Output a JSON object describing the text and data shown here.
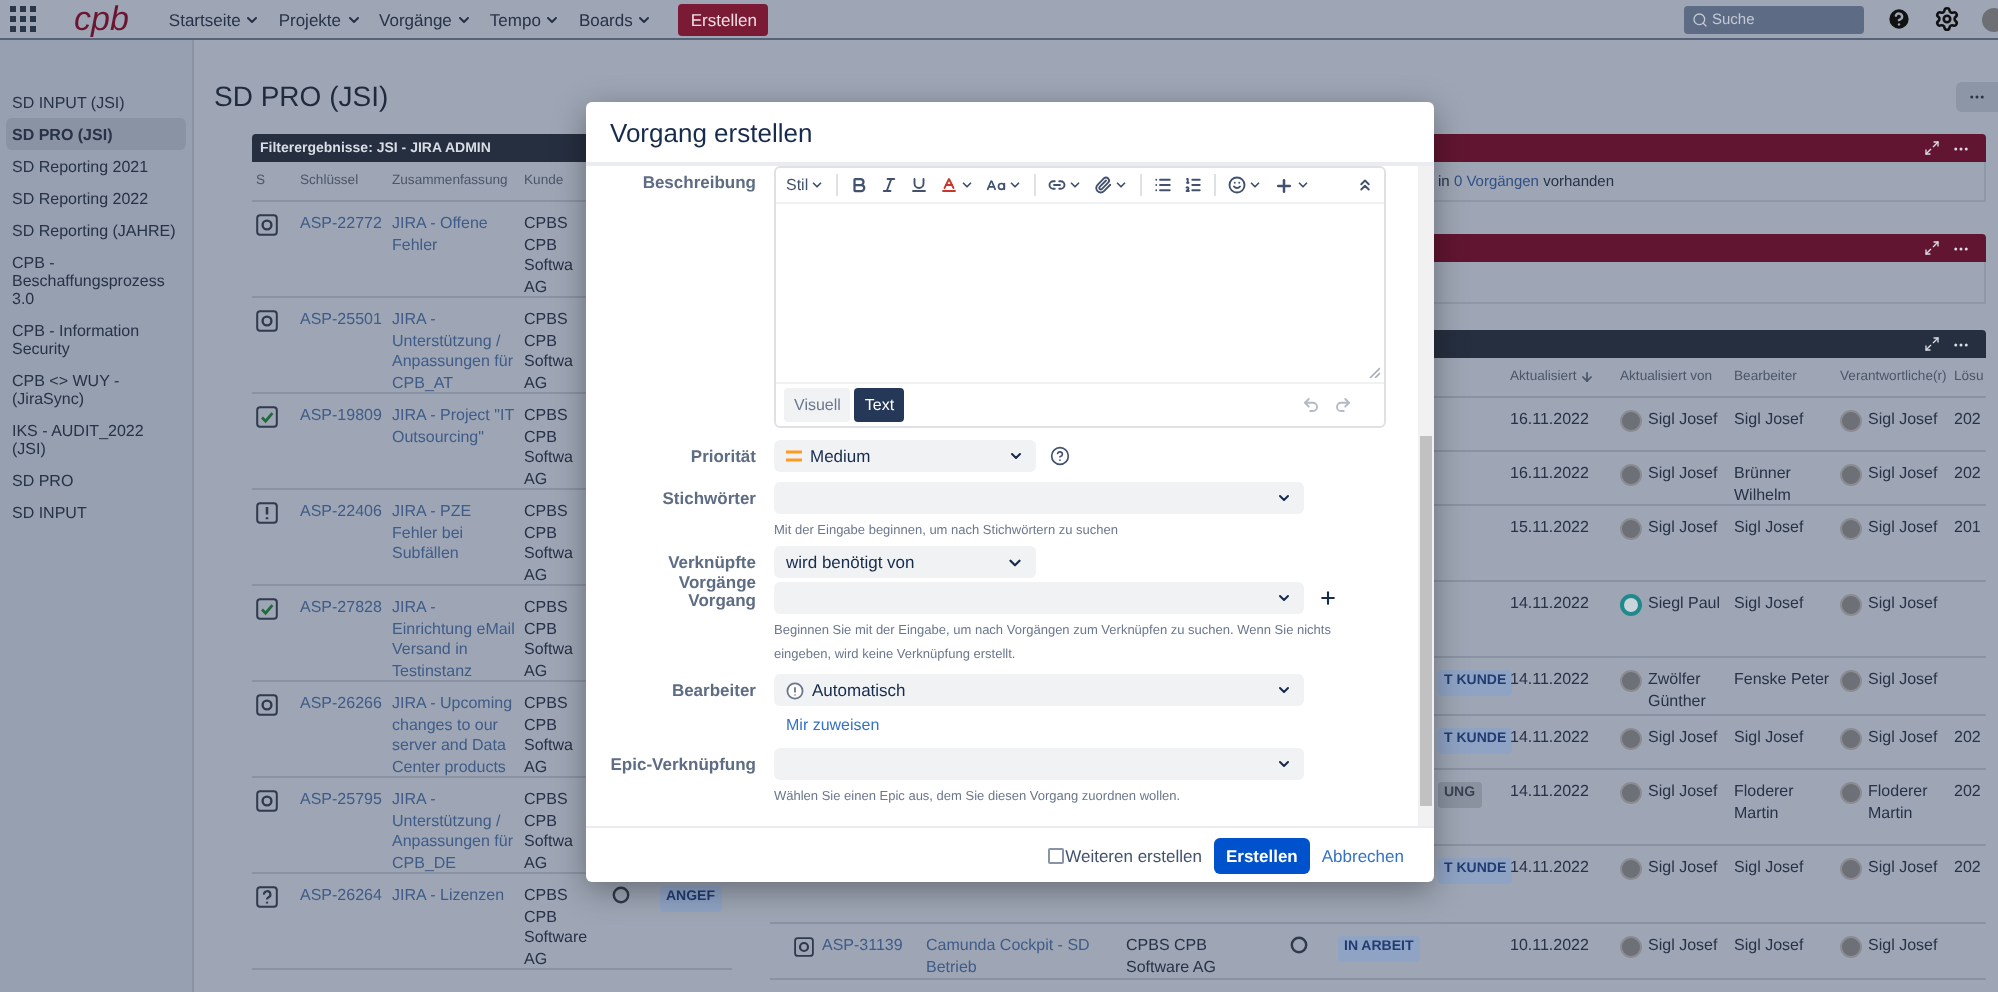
{
  "topbar": {
    "logo": "cpb",
    "nav": [
      "Startseite",
      "Projekte",
      "Vorgänge",
      "Tempo",
      "Boards"
    ],
    "create": "Erstellen",
    "search": {
      "placeholder": "Suche"
    }
  },
  "sidebar": {
    "items": [
      {
        "label": "SD INPUT (JSI)",
        "selected": false
      },
      {
        "label": "SD PRO (JSI)",
        "selected": true
      },
      {
        "label": "SD Reporting 2021",
        "selected": false
      },
      {
        "label": "SD Reporting 2022",
        "selected": false
      },
      {
        "label": "SD Reporting (JAHRE)",
        "selected": false
      },
      {
        "label": "CPB - Beschaffungsprozess 3.0",
        "selected": false
      },
      {
        "label": "CPB - Information Security",
        "selected": false
      },
      {
        "label": "CPB <> WUY - (JiraSync)",
        "selected": false
      },
      {
        "label": "IKS - AUDIT_2022 (JSI)",
        "selected": false
      },
      {
        "label": "SD PRO",
        "selected": false
      },
      {
        "label": "SD INPUT",
        "selected": false
      }
    ]
  },
  "page": {
    "title": "SD PRO (JSI)"
  },
  "filter_gadget": {
    "title": "Filterergebnisse: JSI - JIRA ADMIN",
    "columns": [
      "S",
      "Schlüssel",
      "Zusammenfassung",
      "Kunde"
    ],
    "rows": [
      {
        "kind": "service",
        "key": "ASP-22772",
        "summary": "JIRA - Offene Fehler",
        "customer": "CPBS CPB Softwa AG"
      },
      {
        "kind": "service",
        "key": "ASP-25501",
        "summary": "JIRA - Unterstützung / Anpassungen für CPB_AT",
        "customer": "CPBS CPB Softwa AG"
      },
      {
        "kind": "done",
        "key": "ASP-19809",
        "summary": "JIRA - Project \"IT Outsourcing\"",
        "customer": "CPBS CPB Softwa AG"
      },
      {
        "kind": "alert",
        "key": "ASP-22406",
        "summary": "JIRA - PZE Fehler bei Subfällen",
        "customer": "CPBS CPB Softwa AG"
      },
      {
        "kind": "done",
        "key": "ASP-27828",
        "summary": "JIRA - Einrichtung eMail Versand in Testinstanz",
        "customer": "CPBS CPB Softwa AG"
      },
      {
        "kind": "service",
        "key": "ASP-26266",
        "summary": "JIRA - Upcoming changes to our server and Data Center products",
        "customer": "CPBS CPB Softwa AG"
      },
      {
        "kind": "service",
        "key": "ASP-25795",
        "summary": "JIRA - Unterstützung / Anpassungen für CPB_DE",
        "customer": "CPBS CPB Softwa AG"
      },
      {
        "kind": "question",
        "key": "ASP-26264",
        "summary": "JIRA - Lizenzen",
        "customer": "CPBS CPB Software AG",
        "status_icon": true,
        "badge": {
          "text": "ANGEF",
          "kind": "info"
        }
      }
    ]
  },
  "notice_gadget": {
    "before": "in",
    "link": "0 Vorgängen",
    "after": "vorhanden"
  },
  "issues_gadget": {
    "columns": [
      "Aktualisiert",
      "Aktualisiert von",
      "Bearbeiter",
      "Verantwortliche(r)",
      "Lösu"
    ],
    "rows": [
      {
        "updated": "16.11.2022",
        "updated_by": {
          "name": "Sigl Josef",
          "kind": "photo"
        },
        "assignee": "Sigl Josef",
        "responsible": {
          "name": "Sigl Josef",
          "kind": "photo"
        },
        "resolution": "202"
      },
      {
        "updated": "16.11.2022",
        "updated_by": {
          "name": "Sigl Josef",
          "kind": "photo"
        },
        "assignee": "Brünner Wilhelm",
        "responsible": {
          "name": "Sigl Josef",
          "kind": "photo"
        },
        "resolution": "202"
      },
      {
        "updated": "15.11.2022",
        "updated_by": {
          "name": "Sigl Josef",
          "kind": "photo"
        },
        "assignee": "Sigl Josef",
        "responsible": {
          "name": "Sigl Josef",
          "kind": "photo"
        },
        "resolution": "201"
      },
      {
        "updated": "14.11.2022",
        "updated_by": {
          "name": "Siegl Paul",
          "kind": "default"
        },
        "assignee": "Sigl Josef",
        "responsible": {
          "name": "Sigl Josef",
          "kind": "photo"
        }
      },
      {
        "badge": {
          "text": "T KUNDE",
          "kind": "info"
        },
        "updated": "14.11.2022",
        "updated_by": {
          "name": "Zwölfer Günther",
          "kind": "photo"
        },
        "assignee": "Fenske Peter",
        "responsible": {
          "name": "Sigl Josef",
          "kind": "photo"
        }
      },
      {
        "badge": {
          "text": "T KUNDE",
          "kind": "info"
        },
        "updated": "14.11.2022",
        "updated_by": {
          "name": "Sigl Josef",
          "kind": "photo"
        },
        "assignee": "Sigl Josef",
        "responsible": {
          "name": "Sigl Josef",
          "kind": "photo"
        },
        "resolution": "202"
      },
      {
        "badge": {
          "text": "UNG",
          "kind": "neutral"
        },
        "updated": "14.11.2022",
        "updated_by": {
          "name": "Sigl Josef",
          "kind": "photo"
        },
        "assignee": "Floderer Martin",
        "responsible": {
          "name": "Floderer Martin",
          "kind": "photo"
        },
        "resolution": "202"
      },
      {
        "badge": {
          "text": "T KUNDE",
          "kind": "info"
        },
        "updated": "14.11.2022",
        "updated_by": {
          "name": "Sigl Josef",
          "kind": "photo"
        },
        "assignee": "Sigl Josef",
        "responsible": {
          "name": "Sigl Josef",
          "kind": "photo"
        },
        "resolution": "202"
      },
      {
        "kind": "service",
        "key": "ASP-31139",
        "summary": "Camunda Cockpit - SD Betrieb",
        "customer": "CPBS CPB Software AG",
        "status_icon": true,
        "badge": {
          "text": "IN ARBEIT",
          "kind": "info"
        },
        "updated": "10.11.2022",
        "updated_by": {
          "name": "Sigl Josef",
          "kind": "photo"
        },
        "assignee": "Sigl Josef",
        "responsible": {
          "name": "Sigl Josef",
          "kind": "photo"
        }
      }
    ]
  },
  "dialog": {
    "title": "Vorgang erstellen",
    "description": {
      "label": "Beschreibung",
      "style_menu": "Stil",
      "modes": [
        {
          "label": "Visuell",
          "selected": false
        },
        {
          "label": "Text",
          "selected": true
        }
      ]
    },
    "priority": {
      "label": "Priorität",
      "value": "Medium"
    },
    "labels": {
      "label": "Stichwörter",
      "hint": "Mit der Eingabe beginnen, um nach Stichwörtern zu suchen"
    },
    "links": {
      "label": "Verknüpfte Vorgänge",
      "sublabel": "Vorgang",
      "relation": "wird benötigt von",
      "hint": "Beginnen Sie mit der Eingabe, um nach Vorgängen zum Verknüpfen zu suchen. Wenn Sie nichts eingeben, wird keine Verknüpfung erstellt."
    },
    "assignee": {
      "label": "Bearbeiter",
      "value": "Automatisch",
      "link": "Mir zuweisen"
    },
    "epic": {
      "label": "Epic-Verknüpfung",
      "hint": "Wählen Sie einen Epic aus, dem Sie diesen Vorgang zuordnen wollen."
    },
    "footer": {
      "another": {
        "label": "Weiteren erstellen",
        "checked": false
      },
      "submit": "Erstellen",
      "cancel": "Abbrechen"
    }
  }
}
